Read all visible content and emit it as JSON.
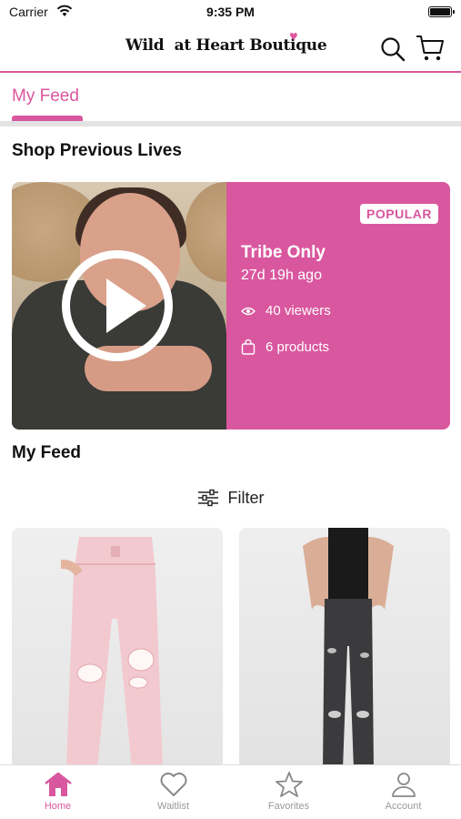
{
  "status_bar": {
    "carrier": "Carrier",
    "time": "9:35 PM"
  },
  "header": {
    "logo": "Wild  at Heart Boutique"
  },
  "tabs": [
    {
      "label": "My Feed",
      "active": true
    }
  ],
  "sections": {
    "previous_lives": "Shop Previous Lives",
    "my_feed": "My Feed"
  },
  "live_card": {
    "badge": "POPULAR",
    "title": "Tribe Only",
    "time_ago": "27d 19h ago",
    "viewers": "40 viewers",
    "products": "6 products"
  },
  "filter": {
    "label": "Filter"
  },
  "products": [
    {
      "image": "light-pink-distressed-jeans"
    },
    {
      "image": "black-distressed-skinny-jeans"
    }
  ],
  "bottom_nav": [
    {
      "label": "Home",
      "icon": "home-icon",
      "active": true
    },
    {
      "label": "Waitlist",
      "icon": "heart-icon",
      "active": false
    },
    {
      "label": "Favorites",
      "icon": "star-icon",
      "active": false
    },
    {
      "label": "Account",
      "icon": "person-icon",
      "active": false
    }
  ],
  "colors": {
    "accent": "#d9579e",
    "badge_text": "#d9579e"
  }
}
